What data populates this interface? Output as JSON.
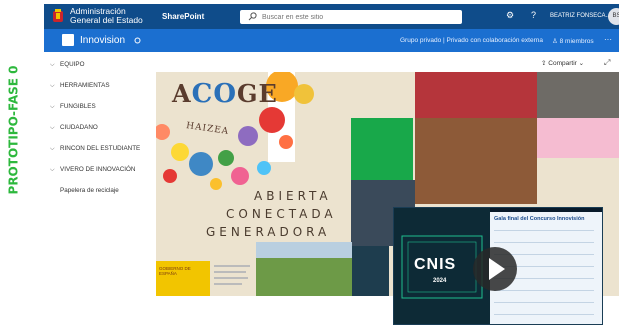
{
  "side_label": "PROTOTIPO-FASE 0",
  "suitebar": {
    "org_line1": "Administración",
    "org_line2": "General del Estado",
    "app_name": "SharePoint",
    "search_placeholder": "Buscar en este sitio",
    "user_name": "BEATRIZ FONSECA...",
    "avatar_initials": "BS",
    "settings_icon": "gear-icon",
    "help_icon": "question-icon"
  },
  "site": {
    "name": "Innovision",
    "meta": "Grupo privado | Privado con colaboración externa",
    "members": "8 miembros",
    "more": "···"
  },
  "nav": {
    "items": [
      {
        "label": "EQUIPO",
        "has_chevron": true
      },
      {
        "label": "HERRAMIENTAS",
        "has_chevron": true
      },
      {
        "label": "FUNGIBLES",
        "has_chevron": true
      },
      {
        "label": "CIUDADANO",
        "has_chevron": true
      },
      {
        "label": "RINCON DEL ESTUDIANTE",
        "has_chevron": true
      },
      {
        "label": "VIVERO DE INNOVACIÓN",
        "has_chevron": true
      },
      {
        "label": "Papelera de reciclaje",
        "has_chevron": false
      }
    ]
  },
  "toolbar": {
    "share_label": "Compartir"
  },
  "banner": {
    "acoge_pre": "A",
    "acoge_mid": "CO",
    "acoge_post": "GE",
    "haizea": "HAIZEA",
    "slogan_1": "ABIERTA",
    "slogan_2": "CONECTADA",
    "slogan_3": "GENERADORA",
    "gobierno": "GOBIERNO DE ESPAÑA"
  },
  "video": {
    "title": "CNIS",
    "year": "2024",
    "panel_title": "Gala final del Concurso Innovisión"
  },
  "colors": {
    "suitebar": "#0f4c8a",
    "sitebar": "#1b6fd0",
    "side_label": "#2db83d"
  }
}
